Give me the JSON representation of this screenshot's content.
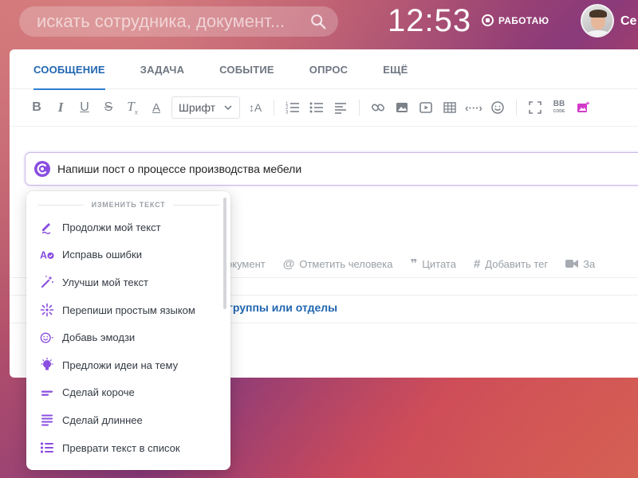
{
  "topbar": {
    "search_placeholder": "искать сотрудника, документ...",
    "clock": "12:53",
    "work_status": "РАБОТАЮ",
    "username": "Се"
  },
  "tabs": [
    {
      "label": "СООБЩЕНИЕ",
      "active": true
    },
    {
      "label": "ЗАДАЧА",
      "active": false
    },
    {
      "label": "СОБЫТИЕ",
      "active": false
    },
    {
      "label": "ОПРОС",
      "active": false
    },
    {
      "label": "ЕЩЁ",
      "active": false
    }
  ],
  "toolbar": {
    "font_select": "Шрифт",
    "icons": [
      "bold-icon",
      "italic-icon",
      "underline-icon",
      "strikethrough-icon",
      "clear-format-icon",
      "font-color-icon",
      "font-size-icon",
      "numbered-list-icon",
      "bullet-list-icon",
      "align-icon",
      "link-icon",
      "image-icon",
      "video-icon",
      "table-icon",
      "code-icon",
      "emoji-icon",
      "fullscreen-icon",
      "bbcode-icon",
      "copilot-image-icon"
    ]
  },
  "prompt": {
    "text": "Напиши пост о процессе производства мебели"
  },
  "actions": [
    {
      "label": "окумент",
      "icon": "document-icon"
    },
    {
      "label": "Отметить человека",
      "icon": "at-icon"
    },
    {
      "label": "Цитата",
      "icon": "quote-icon"
    },
    {
      "label": "Добавить тег",
      "icon": "hash-icon"
    },
    {
      "label": "За",
      "icon": "video-record-icon"
    }
  ],
  "recipients_link": "группы или отделы",
  "menu": {
    "header": "ИЗМЕНИТЬ ТЕКСТ",
    "items": [
      {
        "label": "Продолжи мой текст",
        "icon": "pen-continue-icon"
      },
      {
        "label": "Исправь ошибки",
        "icon": "spellcheck-icon"
      },
      {
        "label": "Улучши мой текст",
        "icon": "magic-wand-icon"
      },
      {
        "label": "Перепиши простым языком",
        "icon": "sparkle-icon"
      },
      {
        "label": "Добавь эмодзи",
        "icon": "emoji-icon"
      },
      {
        "label": "Предложи идеи на тему",
        "icon": "lightbulb-icon"
      },
      {
        "label": "Сделай короче",
        "icon": "shorten-icon"
      },
      {
        "label": "Сделай длиннее",
        "icon": "lengthen-icon"
      },
      {
        "label": "Преврати текст в список",
        "icon": "list-icon"
      }
    ]
  },
  "colors": {
    "accent_blue": "#2066b0",
    "menu_icon_purple": "#8a4ee0",
    "copilot_pink": "#d23ac9"
  }
}
